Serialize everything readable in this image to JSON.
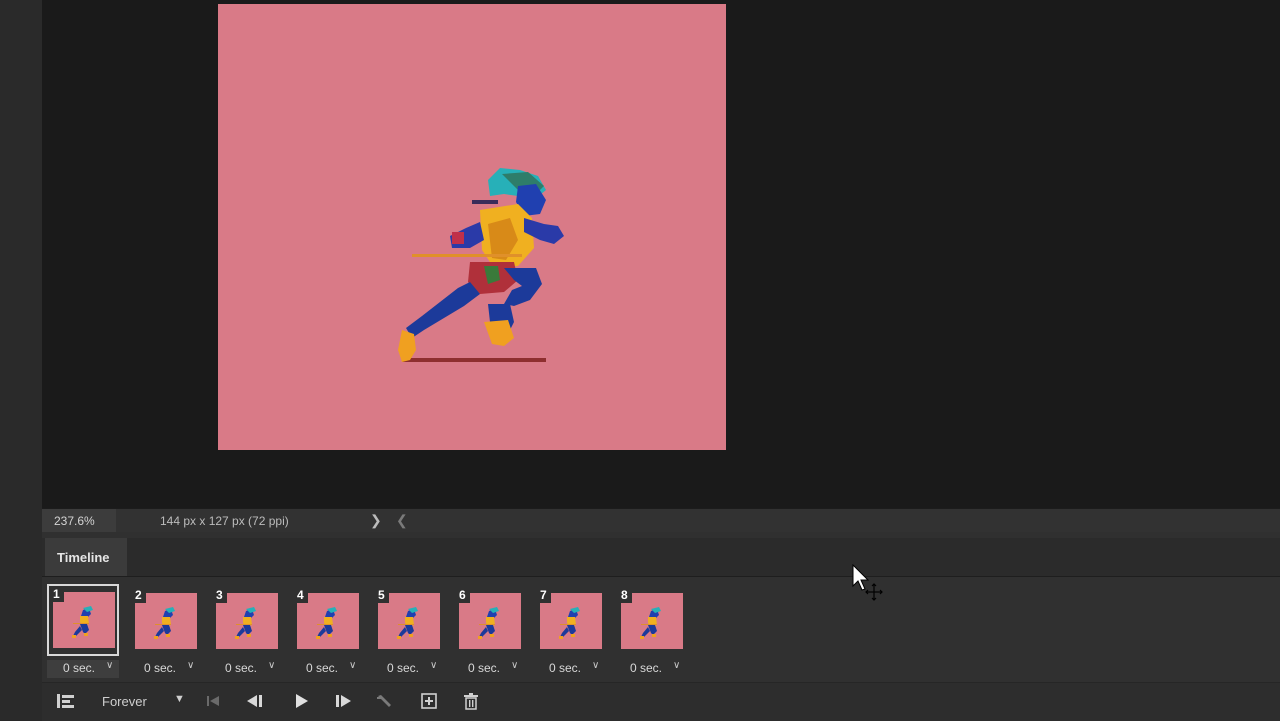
{
  "status": {
    "zoom": "237.6%",
    "doc_info": "144 px x 127 px (72 ppi)",
    "next_glyph": "❯",
    "prev_glyph": "❮"
  },
  "timeline": {
    "title": "Timeline",
    "selected_frame": 1,
    "frames": [
      {
        "number": "1",
        "delay": "0 sec."
      },
      {
        "number": "2",
        "delay": "0 sec."
      },
      {
        "number": "3",
        "delay": "0 sec."
      },
      {
        "number": "4",
        "delay": "0 sec."
      },
      {
        "number": "5",
        "delay": "0 sec."
      },
      {
        "number": "6",
        "delay": "0 sec."
      },
      {
        "number": "7",
        "delay": "0 sec."
      },
      {
        "number": "8",
        "delay": "0 sec."
      }
    ],
    "loop_option": "Forever",
    "controls": [
      "convert-icon",
      "first-frame-icon",
      "previous-frame-icon",
      "play-icon",
      "next-frame-icon",
      "tween-icon",
      "duplicate-frame-icon",
      "trash-icon"
    ]
  },
  "colors": {
    "canvas_bg": "#d97a87",
    "workspace_bg": "#1a1a1a",
    "panel_bg": "#303030"
  },
  "cursor": "move-cursor-icon"
}
